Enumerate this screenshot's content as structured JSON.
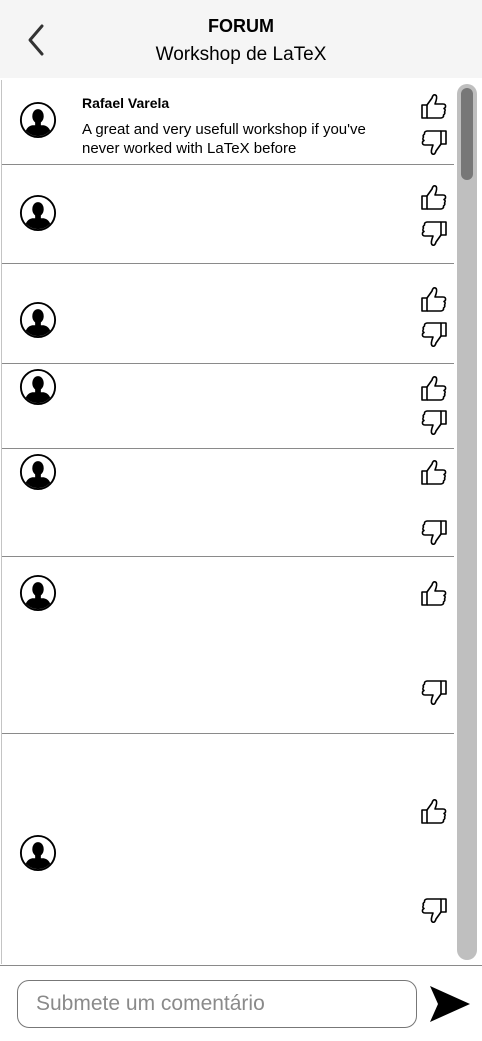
{
  "header": {
    "title": "FORUM",
    "subtitle": "Workshop de LaTeX"
  },
  "icons": {
    "back": "chevron-left-icon",
    "avatar": "user-avatar-icon",
    "like": "thumbs-up-icon",
    "dislike": "thumbs-down-icon",
    "send": "send-icon"
  },
  "posts": [
    {
      "author": "Rafael Varela",
      "text": "A great and very usefull workshop if you've never worked with LaTeX before"
    },
    {
      "author": "",
      "text": ""
    },
    {
      "author": "",
      "text": ""
    },
    {
      "author": "",
      "text": ""
    },
    {
      "author": "",
      "text": ""
    },
    {
      "author": "",
      "text": ""
    },
    {
      "author": "",
      "text": ""
    }
  ],
  "composer": {
    "placeholder": "Submete um comentário",
    "value": ""
  }
}
